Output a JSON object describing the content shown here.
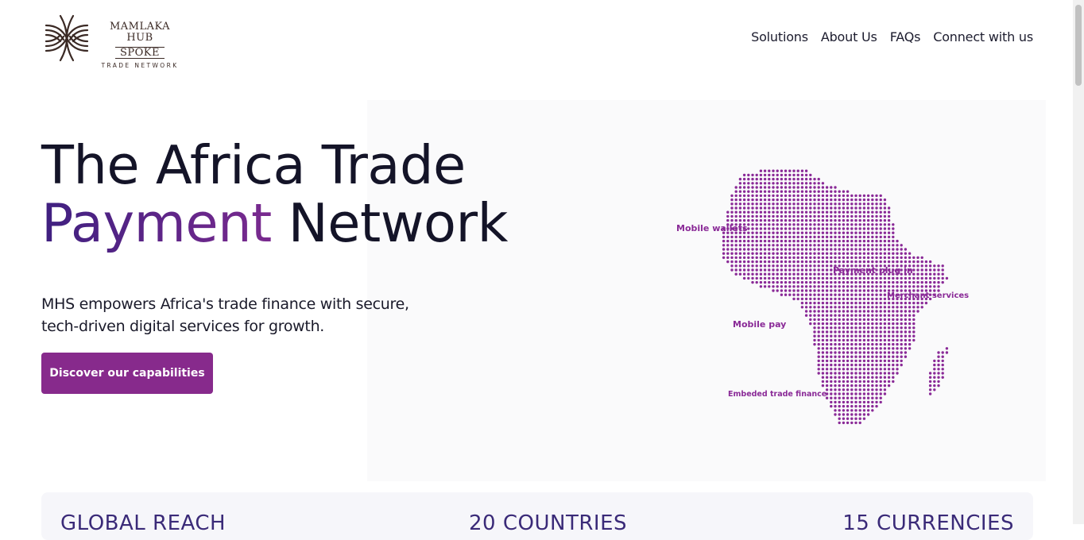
{
  "brand": {
    "line1": "MAMLAKA HUB",
    "line2": "SPOKE",
    "line3": "TRADE NETWORK",
    "logo_icon": "woven-lines-logo-icon"
  },
  "nav": {
    "items": [
      "Solutions",
      "About Us",
      "FAQs",
      "Connect with us"
    ]
  },
  "hero": {
    "title_line1": "The Africa Trade",
    "title_accent": "Payment",
    "title_rest": "Network",
    "subtitle": "MHS empowers Africa's trade finance with secure, tech-driven digital services for growth.",
    "cta_label": "Discover our capabilities",
    "map_labels": {
      "mobile_wallets": "Mobile wallets",
      "payment_plugin": "Payment plug in",
      "merchant_services": "Merchant services",
      "mobile_pay": "Mobile pay",
      "embedded_trade": "Embeded trade finance"
    }
  },
  "stats": [
    "GLOBAL REACH",
    "20 COUNTRIES",
    "15 CURRENCIES"
  ],
  "colors": {
    "accent": "#872a8c",
    "title_gradient_start": "#3f2080",
    "title_gradient_end": "#7a2a8f",
    "map_dots": "#8a2a97",
    "text_dark": "#141428"
  }
}
